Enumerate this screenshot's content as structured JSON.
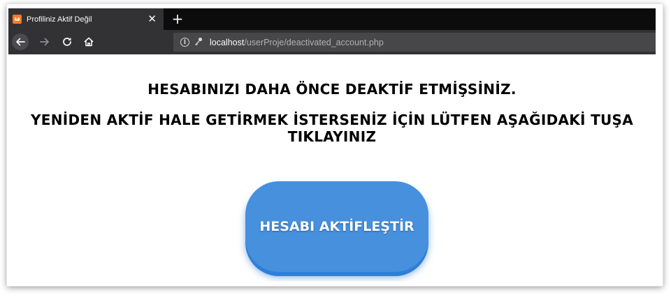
{
  "browser": {
    "tab": {
      "title": "Profiliniz Aktif Değil",
      "favicon": "xampp-icon",
      "close_glyph": "✕"
    },
    "new_tab_glyph": "+",
    "nav": {
      "back_icon": "back-arrow-icon",
      "forward_icon": "forward-arrow-icon",
      "reload_icon": "reload-icon",
      "home_icon": "home-icon"
    },
    "url": {
      "host": "localhost",
      "path": "/userProje/deactivated_account.php"
    }
  },
  "page": {
    "heading1": "HESABINIZI DAHA ÖNCE DEAKTİF ETMİŞSİNİZ.",
    "heading2": "YENİDEN AKTİF HALE GETİRMEK İSTERSENİZ İÇİN LÜTFEN AŞAĞIDAKİ TUŞA TIKLAYINIZ",
    "button_label": "HESABI AKTİFLEŞTİR"
  },
  "colors": {
    "tab_strip": "#0c0c0d",
    "toolbar": "#323234",
    "urlbar": "#474749",
    "button": "#4690de"
  }
}
